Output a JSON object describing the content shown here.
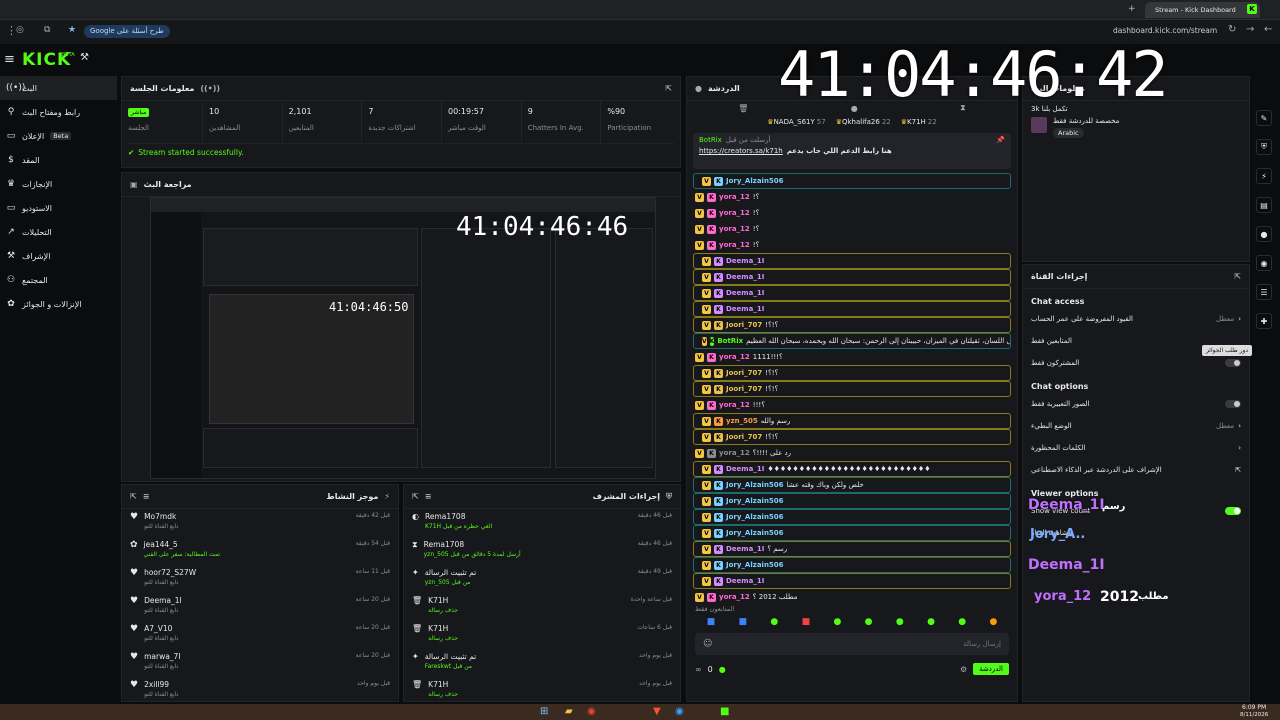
{
  "browser": {
    "new_tab_icon": "+",
    "tab_title": "Stream - Kick Dashboard",
    "url": "dashboard.kick.com/stream",
    "chip": "Google طرح أسئلة على"
  },
  "kick": {
    "logo": "KICK",
    "beta": "BETA"
  },
  "clock": "41:04:46:42",
  "sidebar": {
    "items": [
      {
        "label": "البث",
        "icon": "live-icon"
      },
      {
        "label": "رابط ومفتاح البث",
        "icon": "link-icon"
      },
      {
        "label": "الإعلان",
        "badge": "Beta",
        "icon": "ad-icon"
      },
      {
        "label": "المقد",
        "icon": "money-icon"
      },
      {
        "label": "الإنجازات",
        "icon": "trophy-icon"
      },
      {
        "label": "الاستوديو",
        "icon": "studio-icon"
      },
      {
        "label": "التحليلات",
        "icon": "analytics-icon"
      },
      {
        "label": "الإشراف",
        "icon": "hammer-icon"
      },
      {
        "label": "المجتمع",
        "icon": "community-icon"
      },
      {
        "label": "الإنزالات و الجوائز",
        "icon": "gift-icon"
      }
    ]
  },
  "session": {
    "title": "معلومات الجلسة",
    "live_badge": "مباشر",
    "session_label": "الجلسة",
    "stats": [
      {
        "value": "10",
        "label": "المشاهدين"
      },
      {
        "value": "2,101",
        "label": "المتابعين"
      },
      {
        "value": "7",
        "label": "اشتراكات جديدة"
      },
      {
        "value": "00:19:57",
        "label": "الوقت مباشر"
      },
      {
        "value": "9",
        "label": "Chatters In Avg."
      },
      {
        "value": "%90",
        "label": "Participation"
      }
    ],
    "status": "Stream started successfully."
  },
  "preview": {
    "title": "مراجعة البث",
    "inner_clock": "41:04:46:46",
    "inner_clock2": "41:04:46:50"
  },
  "activity": {
    "title": "موجز النشاط",
    "items": [
      {
        "name": "Mo7mdk",
        "sub": "تابع القناة للتو",
        "time": "قبل 42 دقيقة"
      },
      {
        "name": "jea144_5",
        "sub": "تمت المطالبة: سفر على الفني",
        "time": "قبل 54 دقيقة"
      },
      {
        "name": "hoor72_S27W",
        "sub": "تابع القناة للتو",
        "time": "قبل 11 ساعة"
      },
      {
        "name": "Deema_1I",
        "sub": "تابع القناة للتو",
        "time": "قبل 20 ساعة"
      },
      {
        "name": "A7_V10",
        "sub": "تابع القناة للتو",
        "time": "قبل 20 ساعة"
      },
      {
        "name": "marwa_7I",
        "sub": "تابع القناة للتو",
        "time": "قبل 20 ساعة"
      },
      {
        "name": "2xill99",
        "sub": "تابع القناة للتو",
        "time": "قبل يوم واحد"
      }
    ]
  },
  "modactions": {
    "title": "إجراءات المشرف",
    "items": [
      {
        "name": "Rema1708",
        "sub": "K71H الغي حظره من قبل",
        "time": "قبل 46 دقيقة"
      },
      {
        "name": "Rema1708",
        "sub": "yzn_505 أرسل لمدة 5 دقائق من قبل",
        "time": "قبل 46 دقيقة"
      },
      {
        "name": "تم تثبيت الرسالة",
        "sub": "yzn_505 من قبل",
        "time": "قبل 49 دقيقة"
      },
      {
        "name": "K71H",
        "sub": "حذف رسالة",
        "time": "قبل ساعة واحدة"
      },
      {
        "name": "K71H",
        "sub": "حذف رسالة",
        "time": "قبل 6 ساعات"
      },
      {
        "name": "تم تثبيت الرسالة",
        "sub": "Fareskwt من قبل",
        "time": "قبل يوم واحد"
      },
      {
        "name": "K71H",
        "sub": "حذف رسالة",
        "time": "قبل يوم واحد"
      }
    ]
  },
  "chat": {
    "title": "الدردشة",
    "leaders": [
      {
        "name": "NADA_S61Y",
        "n": "57"
      },
      {
        "name": "Qkhalifa26",
        "n": "22"
      },
      {
        "name": "K71H",
        "n": "22"
      }
    ],
    "pinned_by": "أرسلت من قبل",
    "pinned_user": "BotRix",
    "pinned_text": "هنا رابط الدعم اللي حاب يدعم",
    "pinned_link": "https://creators.sa/k71h",
    "messages": [
      {
        "user": "Jory_Alzain506",
        "text": "",
        "color": "#7ad0ff",
        "hl": "hl2"
      },
      {
        "user": "yora_12",
        "text": "!؟",
        "color": "#ff68d0"
      },
      {
        "user": "yora_12",
        "text": "!؟",
        "color": "#ff68d0"
      },
      {
        "user": "yora_12",
        "text": "!؟",
        "color": "#ff68d0"
      },
      {
        "user": "yora_12",
        "text": "!؟",
        "color": "#ff68d0"
      },
      {
        "user": "Deema_1I",
        "text": "",
        "color": "#d58cff",
        "hl": "hl"
      },
      {
        "user": "Deema_1I",
        "text": "",
        "color": "#d58cff",
        "hl": "hl"
      },
      {
        "user": "Deema_1I",
        "text": "",
        "color": "#d58cff",
        "hl": "hl"
      },
      {
        "user": "Deema_1I",
        "text": "",
        "color": "#d58cff",
        "hl": "hl"
      },
      {
        "user": "Joori_707",
        "text": "!؟!؟",
        "color": "#e8c04c",
        "hl": "hl"
      },
      {
        "user": "BotRix",
        "text": "كلمتان خفيفتان على اللسان، ثقيلتان في الميزان، حبيبتان إلى الرحمن: سبحان الله وبحمده، سبحان الله العظيم",
        "color": "#53fc18",
        "hl": "hl2"
      },
      {
        "user": "yora_12",
        "text": "1111!!!؟",
        "color": "#ff68d0"
      },
      {
        "user": "Joori_707",
        "text": "!؟!؟",
        "color": "#e8c04c",
        "hl": "hl"
      },
      {
        "user": "Joori_707",
        "text": "!؟!؟",
        "color": "#e8c04c",
        "hl": "hl"
      },
      {
        "user": "yora_12",
        "text": "!!!؟",
        "color": "#ff68d0"
      },
      {
        "user": "yzn_505",
        "text": "رسم والله",
        "color": "#ff9a3c",
        "hl": "hl"
      },
      {
        "user": "Joori_707",
        "text": "!؟!؟",
        "color": "#e8c04c",
        "hl": "hl"
      },
      {
        "user": "yora_12",
        "text": "رد على !!!!؟",
        "color": "#8b8d92"
      },
      {
        "user": "Deema_1I",
        "text": "♦♦♦♦♦♦♦♦♦♦♦♦♦♦♦♦♦♦♦♦♦♦♦♦♦♦",
        "color": "#d58cff",
        "hl": "hl"
      },
      {
        "user": "Jory_Alzain506",
        "text": "خلص ولكن وباك وقته عشا",
        "color": "#7ad0ff",
        "hl": "hl2"
      },
      {
        "user": "Jory_Alzain506",
        "text": "",
        "color": "#7ad0ff",
        "hl": "hl2"
      },
      {
        "user": "Jory_Alzain506",
        "text": "",
        "color": "#7ad0ff",
        "hl": "hl2"
      },
      {
        "user": "Jory_Alzain506",
        "text": "",
        "color": "#7ad0ff",
        "hl": "hl2"
      },
      {
        "user": "Deema_1I",
        "text": "رسم ؟",
        "color": "#d58cff",
        "hl": "hl"
      },
      {
        "user": "Jory_Alzain506",
        "text": "",
        "color": "#7ad0ff",
        "hl": "hl2"
      },
      {
        "user": "Deema_1I",
        "text": "",
        "color": "#d58cff",
        "hl": "hl"
      },
      {
        "user": "yora_12",
        "text": "مطلب 2012 ؟",
        "color": "#ff68d0"
      }
    ],
    "followers_hint": "المتابعون فقط",
    "input_placeholder": "إرسال رسالة",
    "send_label": "الدردشة",
    "count": "0"
  },
  "channel_info": {
    "title": "معلومات البث",
    "name": "3k تكمل بلنا",
    "sub": "مخصصة للدردشة فقط",
    "lang": "Arabic"
  },
  "channel_settings": {
    "title": "إجراءات القناة",
    "chat_access": "Chat access",
    "access_rows": [
      {
        "label": "القيود المفروضة على عمر الحساب",
        "value": "معطل",
        "type": "arrow"
      },
      {
        "label": "المتابعين فقط",
        "value": "",
        "type": "none"
      },
      {
        "label": "المشتركون فقط",
        "value": "",
        "type": "toggle"
      }
    ],
    "chat_options": "Chat options",
    "option_rows": [
      {
        "label": "الصور التعبيرية فقط",
        "value": "",
        "type": "toggle"
      },
      {
        "label": "الوضع البطيء",
        "value": "معطل",
        "type": "arrow"
      },
      {
        "label": "الكلمات المحظورة",
        "value": "",
        "type": "arrow"
      },
      {
        "label": "الإشراف على الدردشة عبر الذكاء الاصطناعي",
        "value": "",
        "type": "ext"
      }
    ],
    "viewer_options": "Viewer options",
    "viewer_rows": [
      {
        "label": "Show view count",
        "value": "",
        "type": "toggle-on"
      },
      {
        "label": "مشاهدة القناة",
        "value": "",
        "type": "none"
      }
    ],
    "tooltip": "دور طلب الجوائز"
  },
  "overlay": {
    "u1": "Deema_1I",
    "u1tag": "رسم",
    "u2": "Jory_A..",
    "u3": "Deema_1I",
    "u4": "yora_12",
    "u4text": "2012",
    "u4tag": "مطلب"
  },
  "tray": {
    "time": "6:09 PM",
    "date": "8/11/2026"
  },
  "colors": {
    "accent": "#53fc18",
    "bg": "#0b0c0e",
    "panel": "#17181b"
  }
}
